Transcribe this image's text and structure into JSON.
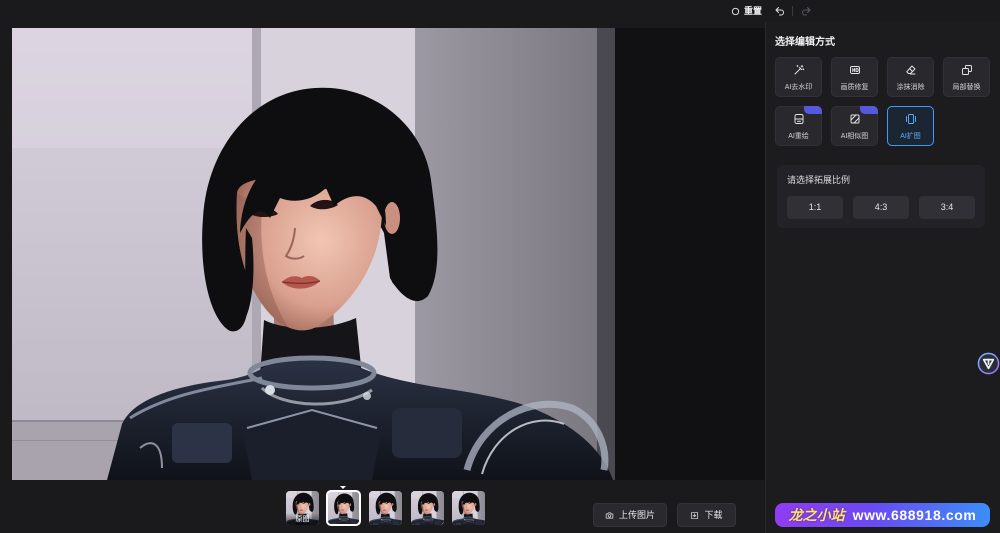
{
  "topbar": {
    "reset_label": "重置",
    "reset_icon": "reset-circle-icon",
    "undo_icon": "undo-icon",
    "redo_icon": "redo-icon",
    "redo_enabled": false
  },
  "panel": {
    "heading": "选择编辑方式",
    "tools": [
      {
        "label": "AI去水印",
        "icon": "magic-wand-icon",
        "selected": false,
        "badge": false
      },
      {
        "label": "画质修复",
        "icon": "hd-quality-icon",
        "selected": false,
        "badge": false
      },
      {
        "label": "涂抹消除",
        "icon": "eraser-icon",
        "selected": false,
        "badge": false
      },
      {
        "label": "局部替换",
        "icon": "partial-replace-icon",
        "selected": false,
        "badge": false
      },
      {
        "label": "AI重绘",
        "icon": "redraw-icon",
        "selected": false,
        "badge": true
      },
      {
        "label": "AI相似图",
        "icon": "similar-image-icon",
        "selected": false,
        "badge": true
      },
      {
        "label": "AI扩图",
        "icon": "expand-image-icon",
        "selected": true,
        "badge": false
      }
    ],
    "ratio_panel": {
      "title": "请选择拓展比例",
      "options": [
        {
          "label": "1:1"
        },
        {
          "label": "4:3"
        },
        {
          "label": "3:4"
        }
      ]
    }
  },
  "thumbnails": [
    {
      "label": "原图",
      "selected": false
    },
    {
      "selected": true
    },
    {
      "selected": false
    },
    {
      "selected": false
    },
    {
      "selected": false
    }
  ],
  "actions": {
    "upload": {
      "label": "上传图片",
      "icon": "camera-icon"
    },
    "download": {
      "label": "下载",
      "icon": "download-icon"
    }
  },
  "floating_button": {
    "icon": "assistant-logo-icon"
  },
  "watermark": {
    "brand": "龙之小站",
    "url": "www.688918.com"
  },
  "colors": {
    "accent": "#3d9bff",
    "badge": "#5659dd",
    "panel_bg": "#1c1c1f",
    "tool_bg": "#28282d",
    "watermark_gradient": [
      "#8f3df0",
      "#3c8ef8"
    ]
  }
}
